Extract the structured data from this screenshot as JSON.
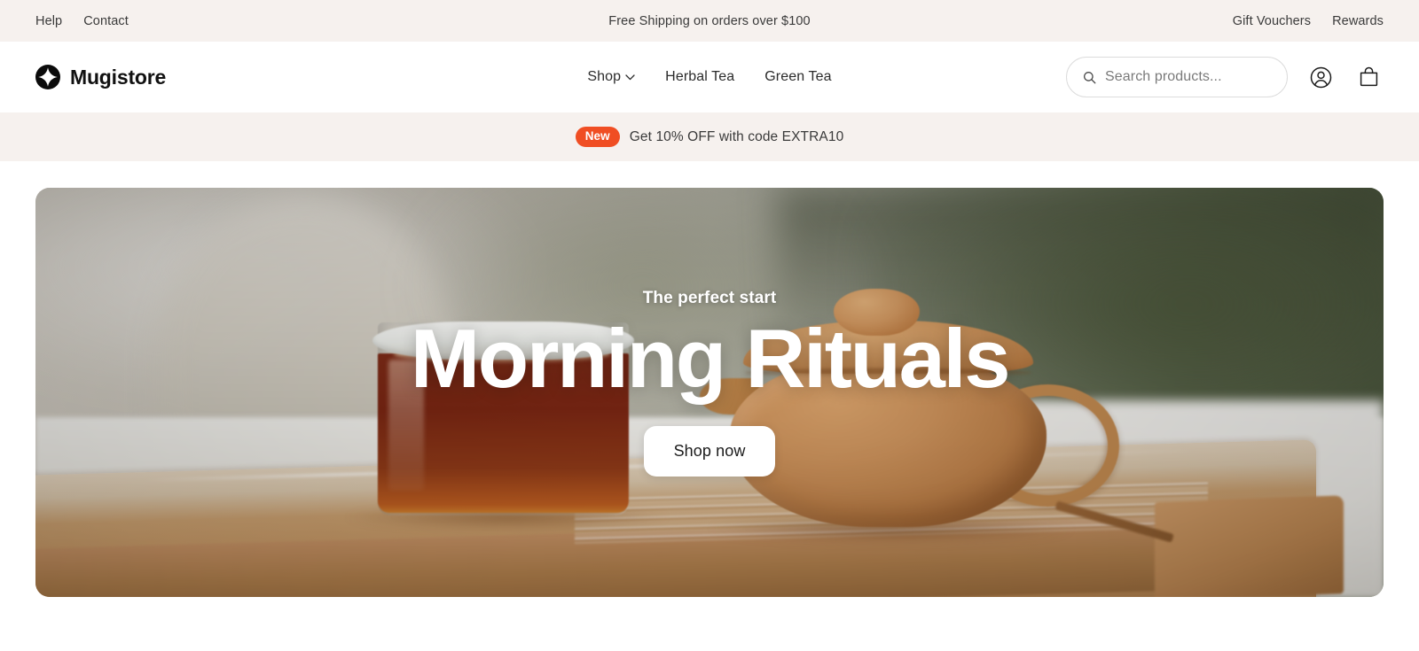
{
  "topbar": {
    "left_links": [
      {
        "label": "Help",
        "name": "topbar-link-help"
      },
      {
        "label": "Contact",
        "name": "topbar-link-contact"
      }
    ],
    "announcement": "Free Shipping on orders over $100",
    "right_links": [
      {
        "label": "Gift Vouchers",
        "name": "topbar-link-gift-vouchers"
      },
      {
        "label": "Rewards",
        "name": "topbar-link-rewards"
      }
    ],
    "background_color": "#F6F1EE"
  },
  "header": {
    "brand_name": "Mugistore",
    "brand_icon": "sparkle-star-icon",
    "nav": [
      {
        "label": "Shop",
        "has_dropdown": true,
        "icon": "chevron-down-icon"
      },
      {
        "label": "Herbal Tea",
        "has_dropdown": false
      },
      {
        "label": "Green Tea",
        "has_dropdown": false
      }
    ],
    "search": {
      "placeholder": "Search products...",
      "value": "",
      "icon": "search-icon"
    },
    "account_icon": "user-circle-icon",
    "cart_icon": "shopping-bag-icon",
    "background_color": "#FFFFFF"
  },
  "promo": {
    "badge": "New",
    "text": "Get 10% OFF with code EXTRA10",
    "badge_color": "#F04E23",
    "background_color": "#F6F1EE"
  },
  "hero": {
    "eyebrow": "The perfect start",
    "title": "Morning Rituals",
    "cta_label": "Shop now",
    "image_alt": "Glass of amber tea and a clay teapot on a wooden tea tray"
  }
}
